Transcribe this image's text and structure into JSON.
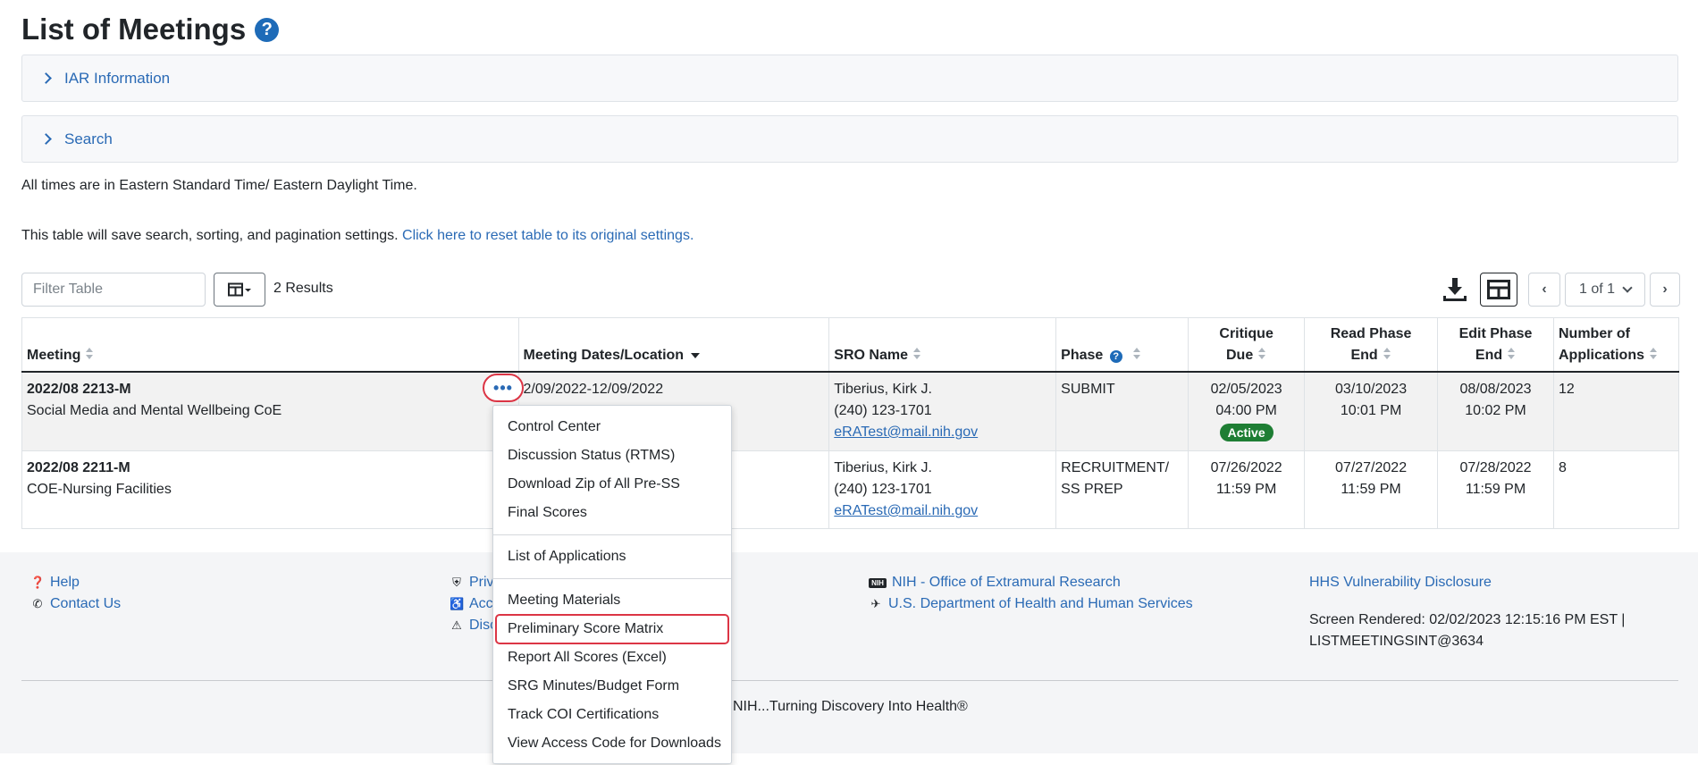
{
  "page": {
    "title": "List of Meetings",
    "title_help_icon": "question-circle-icon"
  },
  "accordions": {
    "iar_label": "IAR Information",
    "search_label": "Search"
  },
  "notes": {
    "timezone": "All times are in Eastern Standard Time/ Eastern Daylight Time.",
    "save_settings": "This table will save search, sorting, and pagination settings.",
    "reset_link": "Click here to reset table to its original settings."
  },
  "toolbar": {
    "filter_placeholder": "Filter Table",
    "results": "2 Results",
    "page_select": "1 of 1",
    "icons": [
      "columns-icon",
      "download-icon",
      "table-view-icon",
      "chevron-left-icon",
      "chevron-right-icon"
    ]
  },
  "table": {
    "headers": {
      "meeting": "Meeting",
      "dates": "Meeting Dates/Location",
      "sro": "SRO Name",
      "phase": "Phase",
      "critique_1": "Critique",
      "critique_2": "Due",
      "read_1": "Read Phase",
      "read_2": "End",
      "edit_1": "Edit Phase",
      "edit_2": "End",
      "num_1": "Number of",
      "num_2": "Applications"
    },
    "rows": [
      {
        "meeting_id": "2022/08 2213-M",
        "meeting_name": "Social Media and Mental Wellbeing CoE",
        "dates": "2/09/2022-12/09/2022",
        "sro_name": "Tiberius, Kirk J.",
        "sro_phone": "(240) 123-1701",
        "sro_email": "eRATest@mail.nih.gov",
        "phase": "SUBMIT",
        "critique_date": "02/05/2023",
        "critique_time": "04:00 PM",
        "status_badge": "Active",
        "read_date": "03/10/2023",
        "read_time": "10:01 PM",
        "edit_date": "08/08/2023",
        "edit_time": "10:02 PM",
        "num_apps": "12"
      },
      {
        "meeting_id": "2022/08 2211-M",
        "meeting_name": "COE-Nursing Facilities",
        "dates": "",
        "sro_name": "Tiberius, Kirk J.",
        "sro_phone": "(240) 123-1701",
        "sro_email": "eRATest@mail.nih.gov",
        "phase_1": "RECRUITMENT/",
        "phase_2": "SS PREP",
        "critique_date": "07/26/2022",
        "critique_time": "11:59 PM",
        "read_date": "07/27/2022",
        "read_time": "11:59 PM",
        "edit_date": "07/28/2022",
        "edit_time": "11:59 PM",
        "num_apps": "8"
      }
    ]
  },
  "actions_menu": {
    "trigger": "•••",
    "group1": [
      "Control Center",
      "Discussion Status (RTMS)",
      "Download Zip of All Pre-SS",
      "Final Scores"
    ],
    "group2": [
      "List of Applications"
    ],
    "group3": [
      "Meeting Materials",
      "Preliminary Score Matrix",
      "Report All Scores (Excel)",
      "SRG Minutes/Budget Form",
      "Track COI Certifications",
      "View Access Code for Downloads"
    ],
    "highlighted": "Preliminary Score Matrix"
  },
  "footer": {
    "help": "Help",
    "contact": "Contact Us",
    "priv_partial": "Priv",
    "acc_partial": "Acc",
    "disc_partial": "Disc",
    "nih_oer": "NIH - Office of Extramural Research",
    "hhs": "U.S. Department of Health and Human Services",
    "vuln": "HHS Vulnerability Disclosure",
    "rendered_1": "Screen Rendered: 02/02/2023 12:15:16 PM EST |",
    "rendered_2": "LISTMEETINGSINT@3634",
    "tagline": "NIH...Turning Discovery Into Health®",
    "icons": [
      "question-circle-icon",
      "phone-icon",
      "shield-icon",
      "accessibility-icon",
      "warning-icon",
      "nih-logo-icon",
      "hhs-eagle-icon"
    ]
  }
}
